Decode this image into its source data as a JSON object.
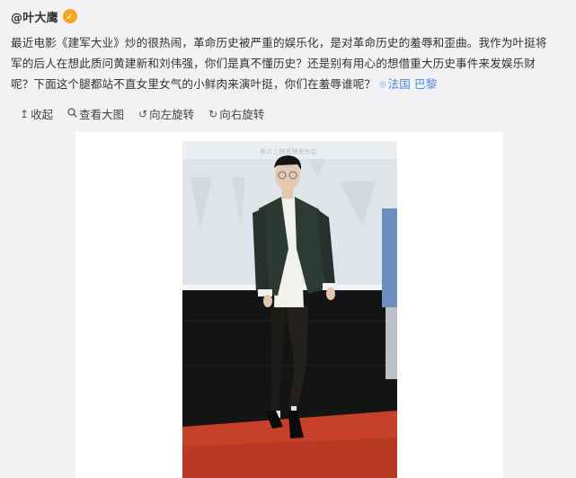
{
  "post": {
    "author": "@叶大鹰",
    "badge": "✓",
    "text_line1": "最近电影《建军大业》炒的很热闹，革命历史被严重的娱乐化，是对革命历史的羞辱和歪曲。我作为叶挺将",
    "text_line2": "军的后人在想此质问黄建新和刘伟强，你们是真不懂历史？还是别有用心的想借重大历史事件来发娱乐财",
    "text_line3": "呢？下面这个腿都站不直女里女气的小鲜肉来演叶挺，你们在羞辱谁呢？",
    "location": "法国 巴黎"
  },
  "actions": {
    "collapse": "收起",
    "view_large": "查看大图",
    "rotate_left": "向左旋转",
    "rotate_right": "向右旋转"
  },
  "photo": {
    "backdrop_text": "影片上映首映发布会"
  }
}
